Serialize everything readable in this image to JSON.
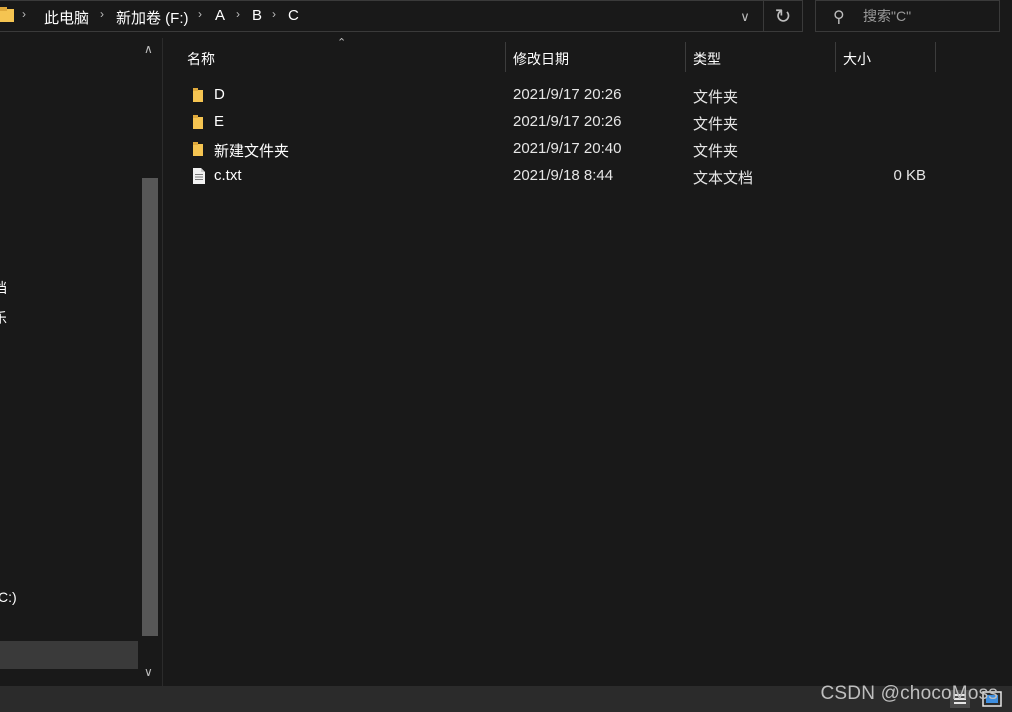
{
  "breadcrumb": {
    "items": [
      "此电脑",
      "新加卷 (F:)",
      "A",
      "B",
      "C"
    ]
  },
  "search": {
    "placeholder": "搜索\"C\""
  },
  "nav": {
    "items": [
      "档",
      "乐",
      "C:)",
      ")"
    ]
  },
  "columns": {
    "name": "名称",
    "date": "修改日期",
    "type": "类型",
    "size": "大小"
  },
  "files": [
    {
      "name": "D",
      "date": "2021/9/17 20:26",
      "type": "文件夹",
      "size": "",
      "icon": "folder-icon"
    },
    {
      "name": "E",
      "date": "2021/9/17 20:26",
      "type": "文件夹",
      "size": "",
      "icon": "folder-icon"
    },
    {
      "name": "新建文件夹",
      "date": "2021/9/17 20:40",
      "type": "文件夹",
      "size": "",
      "icon": "folder-icon"
    },
    {
      "name": "c.txt",
      "date": "2021/9/18 8:44",
      "type": "文本文档",
      "size": "0 KB",
      "icon": "text-file-icon"
    }
  ],
  "watermark": "CSDN @chocoMoss",
  "colors": {
    "background": "#191919",
    "folder": "#f5c451",
    "text": "#ffffff",
    "border": "#3a3a3a"
  }
}
